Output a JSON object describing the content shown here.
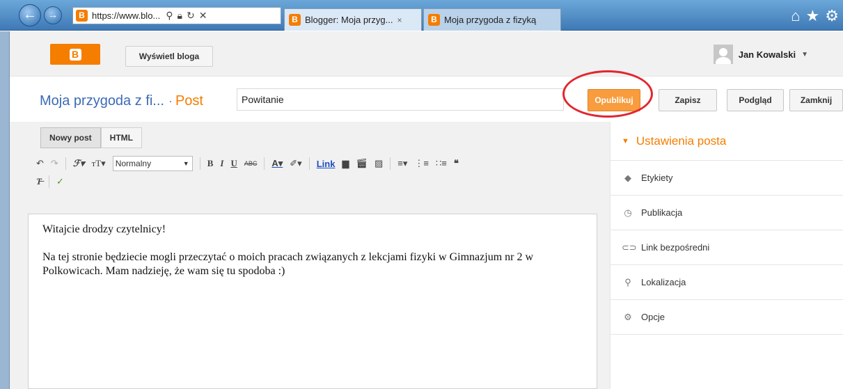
{
  "browser": {
    "address": "https://www.blo...",
    "tabs": [
      {
        "label": "Blogger: Moja przyg...",
        "close": "×"
      },
      {
        "label": "Moja przygoda z fizyką"
      }
    ],
    "nav_icons": [
      "back-arrow-icon",
      "forward-arrow-icon"
    ],
    "right_icons": [
      "home-icon",
      "star-icon",
      "gear-icon"
    ]
  },
  "header": {
    "logo": "B",
    "view_blog": "Wyświetl bloga",
    "user_name": "Jan Kowalski"
  },
  "title_row": {
    "blog_name": "Moja przygoda z fi...",
    "separator": "·",
    "post_label": "Post",
    "title_value": "Powitanie",
    "publish": "Opublikuj",
    "save": "Zapisz",
    "preview": "Podgląd",
    "close": "Zamknij"
  },
  "editor": {
    "tabs": [
      "Nowy post",
      "HTML"
    ],
    "format_value": "Normalny",
    "link_label": "Link",
    "paragraphs": [
      "Witajcie drodzy czytelnicy!",
      "Na tej stronie będziecie mogli przeczytać o moich pracach związanych z lekcjami fizyki w Gimnazjum nr 2 w Polkowicach. Mam nadzieję, że wam się tu spodoba :)"
    ]
  },
  "sidebar": {
    "heading": "Ustawienia posta",
    "items": [
      {
        "label": "Etykiety",
        "icon": "tag-icon"
      },
      {
        "label": "Publikacja",
        "icon": "clock-icon"
      },
      {
        "label": "Link bezpośredni",
        "icon": "link-icon"
      },
      {
        "label": "Lokalizacja",
        "icon": "location-pin-icon"
      },
      {
        "label": "Opcje",
        "icon": "gear-icon"
      }
    ]
  },
  "colors": {
    "accent": "#f57d00",
    "publish": "#f89c3d",
    "link": "#3b6bb5",
    "highlight_oval": "#e2262e"
  }
}
